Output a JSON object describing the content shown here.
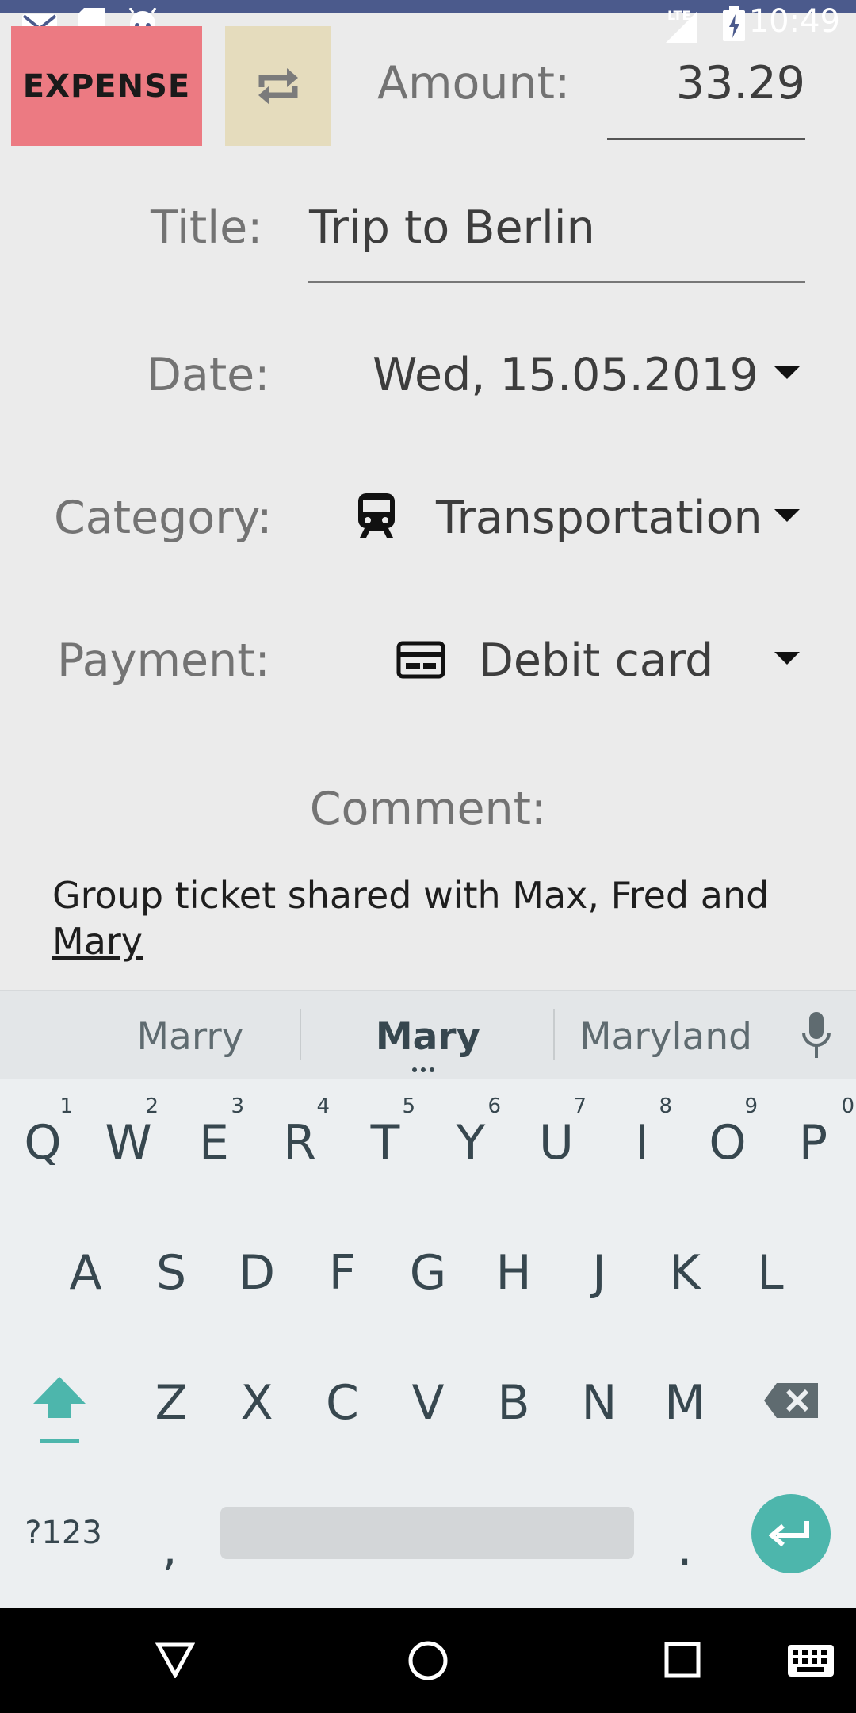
{
  "status_bar": {
    "time": "10:49",
    "network": "LTE"
  },
  "top_row": {
    "expense_label": "EXPENSE",
    "amount_label": "Amount:",
    "amount_value": "33.29"
  },
  "form": {
    "title_label": "Title:",
    "title_value": "Trip to Berlin",
    "date_label": "Date:",
    "date_value": "Wed, 15.05.2019",
    "category_label": "Category:",
    "category_value": "Transportation",
    "category_icon": "train-icon",
    "payment_label": "Payment:",
    "payment_value": "Debit card",
    "payment_icon": "card-icon",
    "comment_label": "Comment:",
    "comment_line1": "Group ticket shared with Max, Fred and",
    "comment_line2": "Mary"
  },
  "keyboard": {
    "suggestions": [
      "Marry",
      "Mary",
      "Maryland"
    ],
    "row1": [
      {
        "key": "Q",
        "hint": "1"
      },
      {
        "key": "W",
        "hint": "2"
      },
      {
        "key": "E",
        "hint": "3"
      },
      {
        "key": "R",
        "hint": "4"
      },
      {
        "key": "T",
        "hint": "5"
      },
      {
        "key": "Y",
        "hint": "6"
      },
      {
        "key": "U",
        "hint": "7"
      },
      {
        "key": "I",
        "hint": "8"
      },
      {
        "key": "O",
        "hint": "9"
      },
      {
        "key": "P",
        "hint": "0"
      }
    ],
    "row2": [
      "A",
      "S",
      "D",
      "F",
      "G",
      "H",
      "J",
      "K",
      "L"
    ],
    "row3": [
      "Z",
      "X",
      "C",
      "V",
      "B",
      "N",
      "M"
    ],
    "symbols_label": "?123",
    "comma_label": ",",
    "period_label": ".",
    "accent_color": "#4db6ac"
  },
  "colors": {
    "expense": "#ec7a82",
    "swap": "#e5dcbd",
    "status_accent": "#4b5a8c"
  }
}
